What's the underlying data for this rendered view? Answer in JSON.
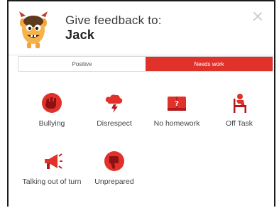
{
  "header": {
    "prompt": "Give feedback to:",
    "student_name": "Jack"
  },
  "tabs": {
    "positive_label": "Positive",
    "needs_work_label": "Needs work",
    "active": "needs_work"
  },
  "behaviors": [
    {
      "label": "Bullying",
      "icon": "hand-stop-icon"
    },
    {
      "label": "Disrespect",
      "icon": "cloud-storm-icon"
    },
    {
      "label": "No homework",
      "icon": "book-question-icon"
    },
    {
      "label": "Off Task",
      "icon": "chair-person-icon"
    },
    {
      "label": "Talking out of turn",
      "icon": "megaphone-icon"
    },
    {
      "label": "Unprepared",
      "icon": "thumbs-down-icon"
    }
  ],
  "colors": {
    "accent": "#e0312b",
    "icon_dark": "#a4161a"
  }
}
